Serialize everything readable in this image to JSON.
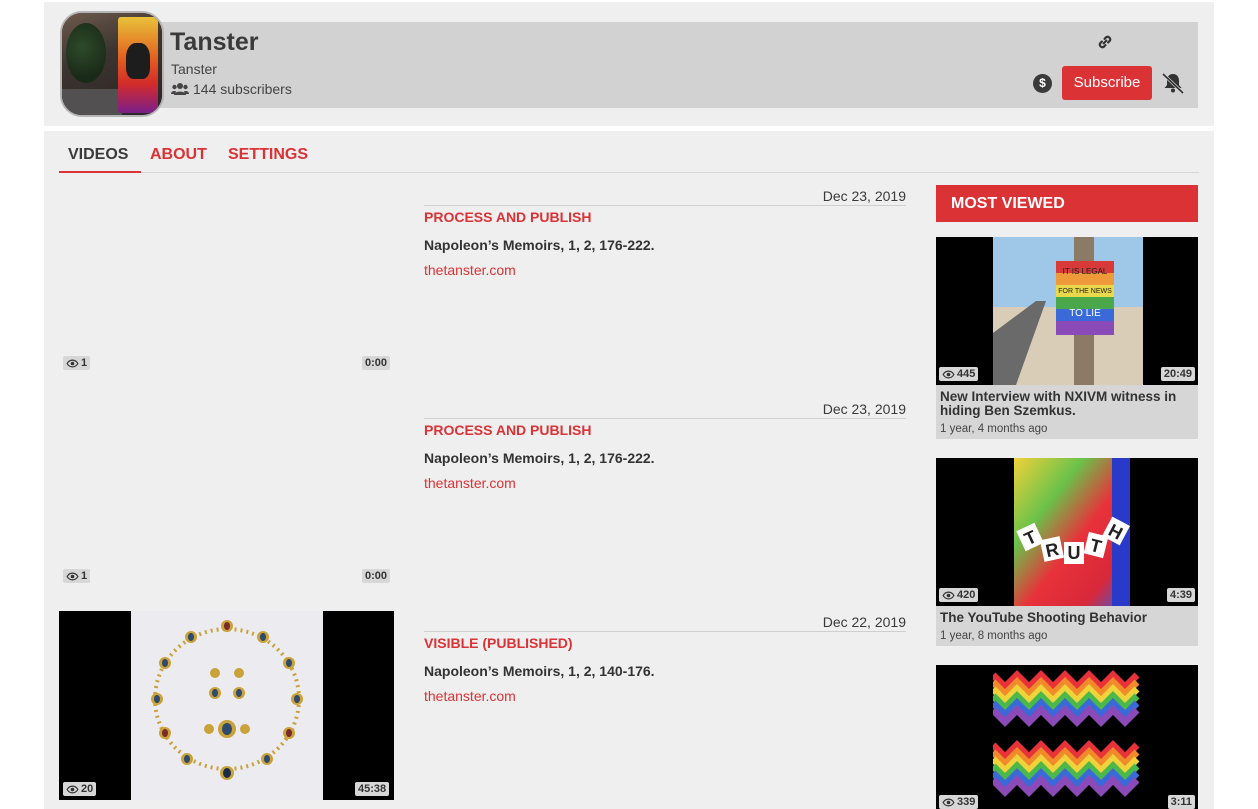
{
  "channel": {
    "name": "Tanster",
    "handle": "Tanster",
    "subscribers": "144 subscribers",
    "subscribe_label": "Subscribe",
    "icons": [
      "link-icon",
      "dollar-icon",
      "bell-off-icon",
      "users-icon"
    ]
  },
  "tabs": [
    {
      "label": "VIDEOS",
      "active": true
    },
    {
      "label": "ABOUT",
      "active": false
    },
    {
      "label": "SETTINGS",
      "active": false
    }
  ],
  "videos": [
    {
      "date": "Dec 23, 2019",
      "status": "PROCESS AND PUBLISH",
      "title": "Napoleon’s Memoirs, 1, 2, 176-222.",
      "link": "thetanster.com",
      "views": "1",
      "duration": "0:00"
    },
    {
      "date": "Dec 23, 2019",
      "status": "PROCESS AND PUBLISH",
      "title": "Napoleon’s Memoirs, 1, 2, 176-222.",
      "link": "thetanster.com",
      "views": "1",
      "duration": "0:00"
    },
    {
      "date": "Dec 22, 2019",
      "status": "VISIBLE (PUBLISHED)",
      "title": "Napoleon’s Memoirs, 1, 2, 140-176.",
      "link": "thetanster.com",
      "views": "20",
      "duration": "45:38"
    }
  ],
  "sidebar": {
    "heading": "MOST VIEWED",
    "items": [
      {
        "title": "New Interview with NXIVM witness in hiding Ben Szemkus.",
        "age": "1 year, 4 months ago",
        "views": "445",
        "duration": "20:49",
        "sign_text": [
          "IT IS LEGAL",
          "FOR THE NEWS",
          "TO LIE"
        ]
      },
      {
        "title": "The YouTube Shooting Behavior",
        "age": "1 year, 8 months ago",
        "views": "420",
        "duration": "4:39",
        "banner_letters": [
          "T",
          "R",
          "U",
          "T",
          "H"
        ]
      },
      {
        "title": "",
        "age": "",
        "views": "339",
        "duration": "3:11"
      }
    ]
  },
  "colors": {
    "accent": "#db3236",
    "panel": "#efefef",
    "header_bar": "#d2d2d2"
  }
}
